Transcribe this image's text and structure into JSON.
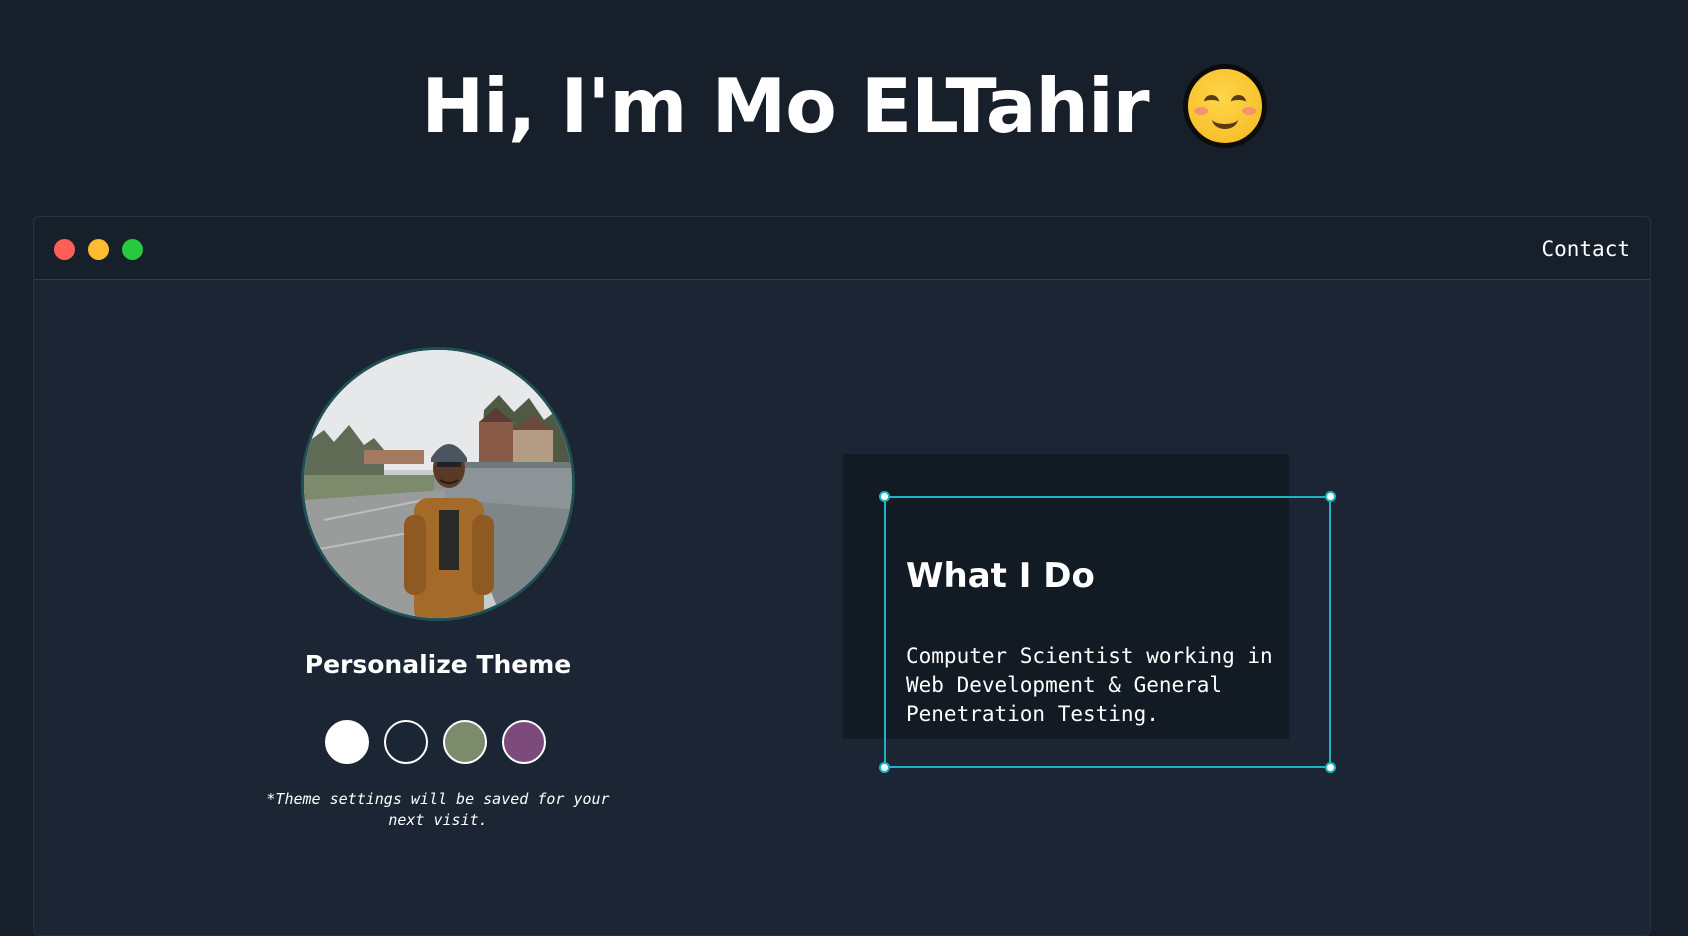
{
  "hero": {
    "title": "Hi, I'm Mo ELTahir",
    "emoji_icon": "smiling-face-emoji"
  },
  "window": {
    "controls": [
      "close",
      "minimize",
      "maximize"
    ],
    "control_colors": {
      "close": "#ff5f57",
      "minimize": "#febc2e",
      "maximize": "#28c840"
    },
    "nav": {
      "contact_label": "Contact"
    }
  },
  "profile": {
    "avatar_icon": "profile-photo"
  },
  "theme": {
    "title": "Personalize Theme",
    "swatches": [
      {
        "name": "white",
        "color": "#ffffff"
      },
      {
        "name": "dark",
        "color": "#1b2533"
      },
      {
        "name": "green",
        "color": "#7c8b6c"
      },
      {
        "name": "purple",
        "color": "#7d4a7c"
      }
    ],
    "note": "*Theme settings will be saved for your next visit."
  },
  "about": {
    "title": "What I Do",
    "description": "Computer Scientist working in Web Development & General Penetration Testing."
  },
  "colors": {
    "background": "#171f2a",
    "window": "#1b2533",
    "accent": "#1fb2c2"
  }
}
